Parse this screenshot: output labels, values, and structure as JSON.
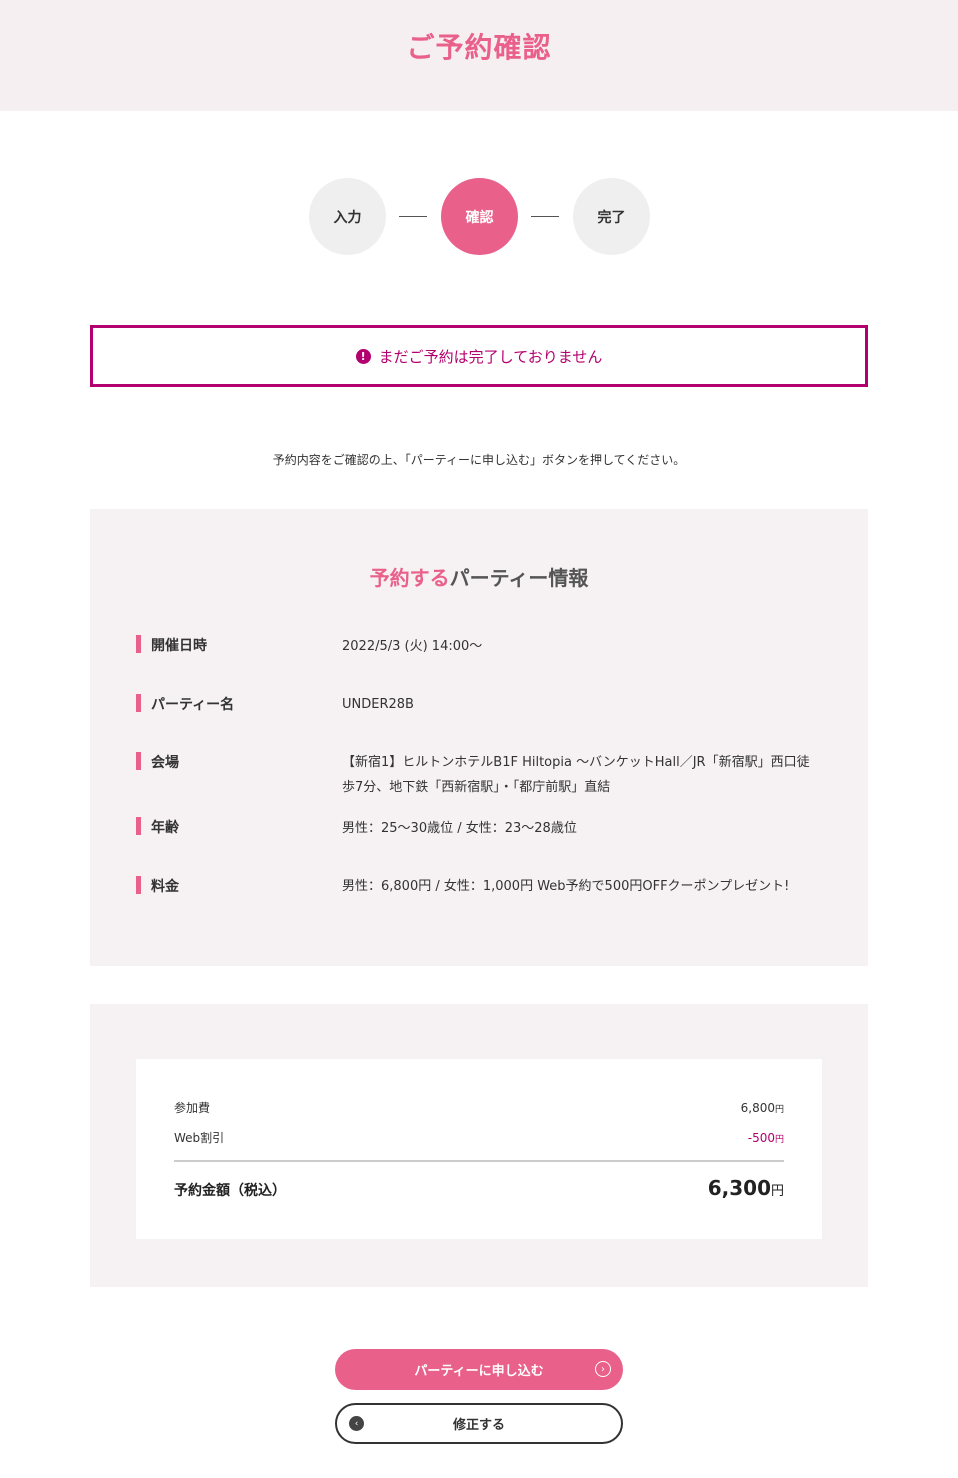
{
  "header": {
    "title": "ご予約確認"
  },
  "steps": [
    {
      "label": "入力"
    },
    {
      "label": "確認"
    },
    {
      "label": "完了"
    }
  ],
  "notice": {
    "icon": "exclamation-circle-icon",
    "text": "まだご予約は完了しておりません"
  },
  "instruction": "予約内容をご確認の上、「パーティーに申し込む」ボタンを押してください。",
  "party": {
    "heading_accent": "予約する",
    "heading_rest": "パーティー情報",
    "rows": [
      {
        "label": "開催日時",
        "value": "2022/5/3 (火) 14:00〜"
      },
      {
        "label": "パーティー名",
        "value": "UNDER28B"
      },
      {
        "label": "会場",
        "value": "【新宿1】ヒルトンホテルB1F Hiltopia 〜バンケットHall／JR「新宿駅」西口徒歩7分、地下鉄「西新宿駅」・「都庁前駅」直結"
      },
      {
        "label": "年齢",
        "value": "男性：25〜30歳位 / 女性：23〜28歳位"
      },
      {
        "label": "料金",
        "value": "男性：6,800円 / 女性：1,000円 Web予約で500円OFFクーポンプレゼント!"
      }
    ]
  },
  "price": {
    "fee_label": "参加費",
    "fee_value": "6,800",
    "discount_label": "Web割引",
    "discount_value": "-500",
    "yen": "円",
    "total_label": "予約金額（税込）",
    "total_value": "6,300"
  },
  "buttons": {
    "apply": "パーティーに申し込む",
    "fix": "修正する"
  },
  "colors": {
    "accent": "#e9608a",
    "warning": "#b3006e",
    "panel": "#f6f1f3"
  }
}
